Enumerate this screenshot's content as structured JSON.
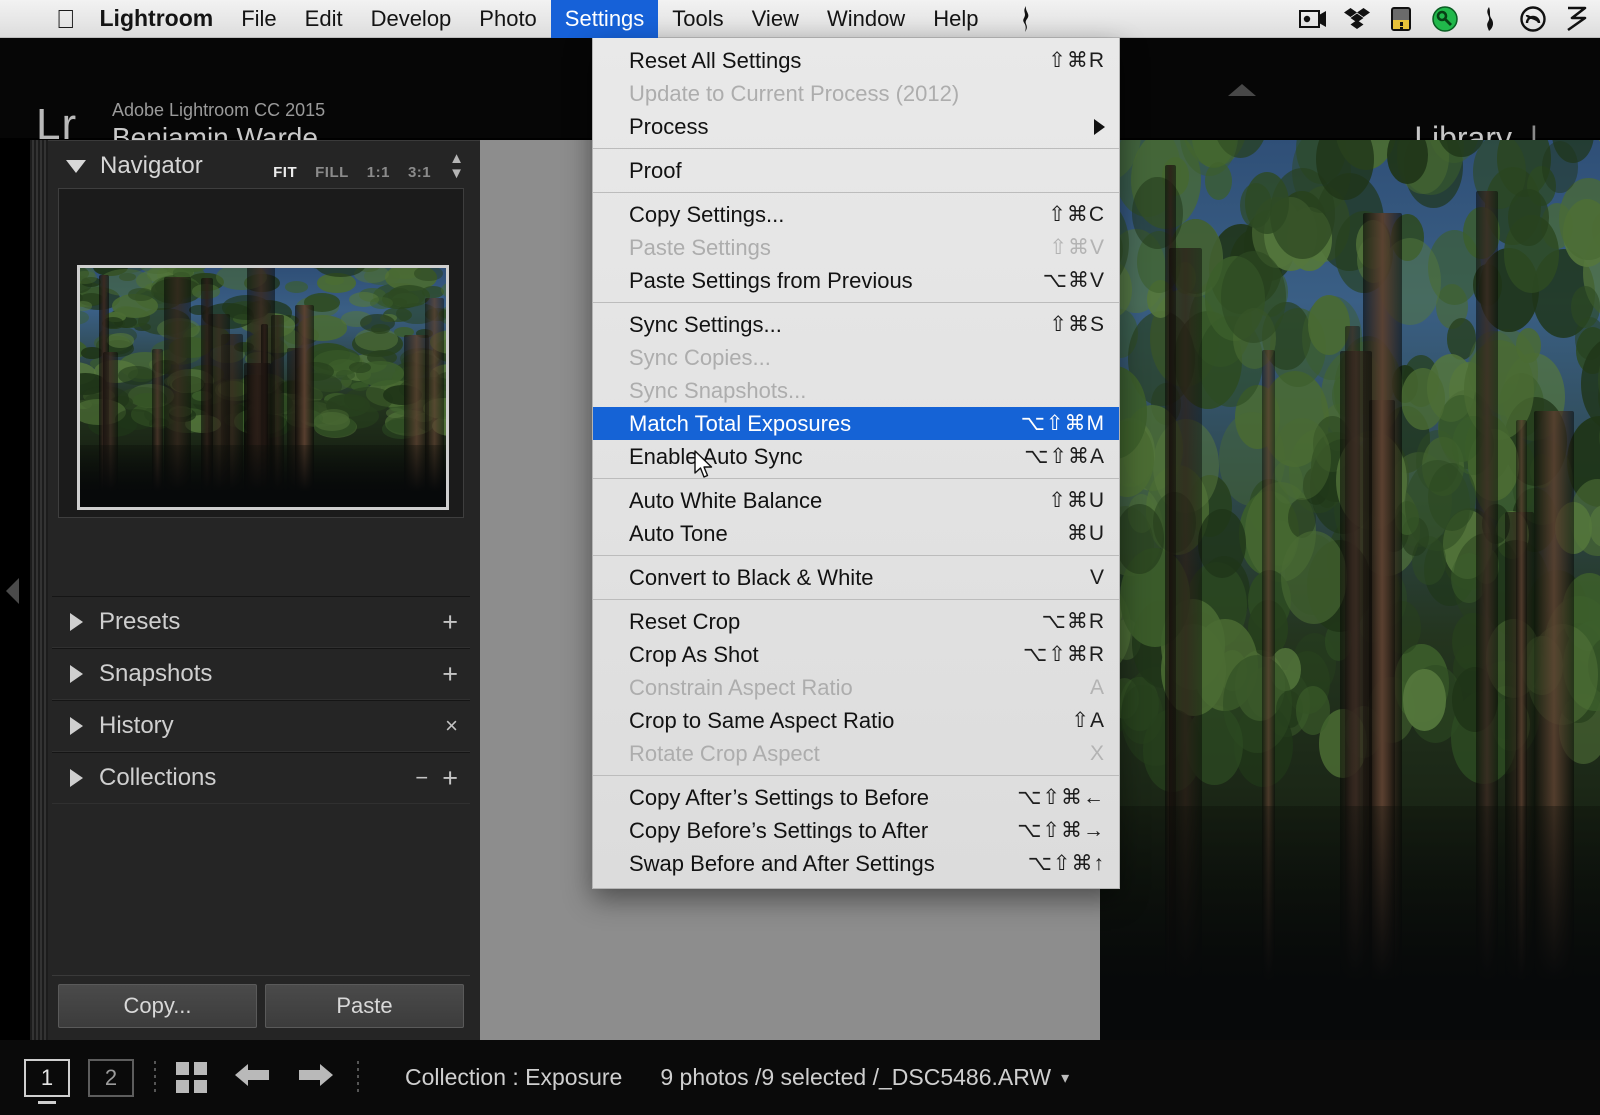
{
  "menubar": {
    "apple_icon": "apple-logo-icon",
    "items": [
      {
        "label": "Lightroom",
        "active": false,
        "bold": true
      },
      {
        "label": "File",
        "active": false
      },
      {
        "label": "Edit",
        "active": false
      },
      {
        "label": "Develop",
        "active": false
      },
      {
        "label": "Photo",
        "active": false
      },
      {
        "label": "Settings",
        "active": true
      },
      {
        "label": "Tools",
        "active": false
      },
      {
        "label": "View",
        "active": false
      },
      {
        "label": "Window",
        "active": false
      },
      {
        "label": "Help",
        "active": false
      }
    ],
    "status_icons": [
      {
        "name": "flame-glyph-icon",
        "glyph": "̦"
      },
      {
        "name": "screen-recorder-icon",
        "glyph": "▣"
      },
      {
        "name": "dropbox-icon",
        "glyph": "❖"
      },
      {
        "name": "battery-warning-icon",
        "glyph": "▮"
      },
      {
        "name": "green-key-icon",
        "glyph": "●"
      },
      {
        "name": "flame-icon",
        "glyph": "◆"
      },
      {
        "name": "creative-cloud-icon",
        "glyph": "Ⓒ"
      },
      {
        "name": "zed-icon",
        "glyph": "ʒ"
      }
    ]
  },
  "header": {
    "logo": "Lr",
    "product": "Adobe Lightroom CC 2015",
    "user": "Benjamin Warde",
    "module": "Library",
    "module_divider": "|"
  },
  "navigator": {
    "title": "Navigator",
    "zoom_options": [
      {
        "label": "FIT",
        "selected": true
      },
      {
        "label": "FILL",
        "selected": false
      },
      {
        "label": "1:1",
        "selected": false
      },
      {
        "label": "3:1",
        "selected": false
      }
    ],
    "stepper_icon": "up-down-stepper-icon"
  },
  "panels": [
    {
      "label": "Presets",
      "actions": [
        "+"
      ]
    },
    {
      "label": "Snapshots",
      "actions": [
        "+"
      ]
    },
    {
      "label": "History",
      "actions": [
        "×"
      ]
    },
    {
      "label": "Collections",
      "actions": [
        "−",
        "+"
      ]
    }
  ],
  "panel_buttons": {
    "copy": "Copy...",
    "paste": "Paste"
  },
  "settings_menu": {
    "groups": [
      {
        "items": [
          {
            "label": "Reset All Settings",
            "shortcut": "⇧⌘R",
            "disabled": false
          },
          {
            "label": "Update to Current Process (2012)",
            "shortcut": "",
            "disabled": true
          },
          {
            "label": "Process",
            "shortcut": "",
            "disabled": false,
            "submenu": true
          }
        ]
      },
      {
        "items": [
          {
            "label": "Proof",
            "shortcut": "",
            "disabled": false
          }
        ]
      },
      {
        "items": [
          {
            "label": "Copy Settings...",
            "shortcut": "⇧⌘C",
            "disabled": false
          },
          {
            "label": "Paste Settings",
            "shortcut": "⇧⌘V",
            "disabled": true
          },
          {
            "label": "Paste Settings from Previous",
            "shortcut": "⌥⌘V",
            "disabled": false
          }
        ]
      },
      {
        "items": [
          {
            "label": "Sync Settings...",
            "shortcut": "⇧⌘S",
            "disabled": false
          },
          {
            "label": "Sync Copies...",
            "shortcut": "",
            "disabled": true
          },
          {
            "label": "Sync Snapshots...",
            "shortcut": "",
            "disabled": true
          },
          {
            "label": "Match Total Exposures",
            "shortcut": "⌥⇧⌘M",
            "disabled": false,
            "highlighted": true
          },
          {
            "label": "Enable Auto Sync",
            "shortcut": "⌥⇧⌘A",
            "disabled": false
          }
        ]
      },
      {
        "items": [
          {
            "label": "Auto White Balance",
            "shortcut": "⇧⌘U",
            "disabled": false
          },
          {
            "label": "Auto Tone",
            "shortcut": "⌘U",
            "disabled": false
          }
        ]
      },
      {
        "items": [
          {
            "label": "Convert to Black & White",
            "shortcut": "V",
            "disabled": false
          }
        ]
      },
      {
        "items": [
          {
            "label": "Reset Crop",
            "shortcut": "⌥⌘R",
            "disabled": false
          },
          {
            "label": "Crop As Shot",
            "shortcut": "⌥⇧⌘R",
            "disabled": false
          },
          {
            "label": "Constrain Aspect Ratio",
            "shortcut": "A",
            "disabled": true
          },
          {
            "label": "Crop to Same Aspect Ratio",
            "shortcut": "⇧A",
            "disabled": false
          },
          {
            "label": "Rotate Crop Aspect",
            "shortcut": "X",
            "disabled": true
          }
        ]
      },
      {
        "items": [
          {
            "label": "Copy After’s Settings to Before",
            "shortcut": "⌥⇧⌘←",
            "disabled": false
          },
          {
            "label": "Copy Before’s Settings to After",
            "shortcut": "⌥⇧⌘→",
            "disabled": false
          },
          {
            "label": "Swap Before and After Settings",
            "shortcut": "⌥⇧⌘↑",
            "disabled": false
          }
        ]
      }
    ]
  },
  "statusbar": {
    "screen_one": "1",
    "screen_two": "2",
    "grid_icon": "grid-view-icon",
    "prev_icon": "previous-arrow-icon",
    "next_icon": "next-arrow-icon",
    "collection": "Collection : Exposure",
    "photos": "9 photos /9 selected /_DSC5486.ARW",
    "caret": "▾"
  },
  "colors": {
    "accent_blue": "#1563d6",
    "menubar_bg": "#e7e7e7",
    "panel_bg": "#252525",
    "app_bg": "#060606",
    "stage_bg": "#8d8d8d"
  }
}
